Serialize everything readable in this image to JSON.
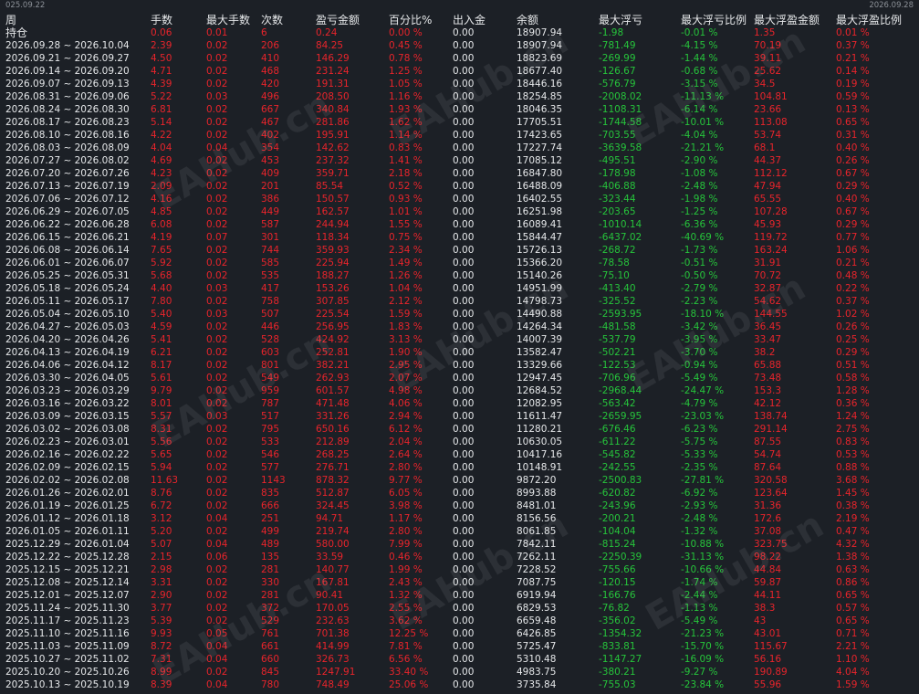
{
  "range": {
    "start": "025.09.22",
    "end": "2026.09.28"
  },
  "headers": [
    "周",
    "手数",
    "最大手数",
    "次数",
    "盈亏金额",
    "百分比%",
    "出入金",
    "余额",
    "最大浮亏",
    "最大浮亏比例",
    "最大浮盈金额",
    "最大浮盈比例"
  ],
  "holding": [
    "持仓",
    "0.06",
    "0.01",
    "6",
    "0.24",
    "0.00 %",
    "0.00",
    "18907.94",
    "-1.98",
    "-0.01 %",
    "1.35",
    "0.01 %"
  ],
  "rows": [
    [
      "2026.09.28 ~ 2026.10.04",
      "2.39",
      "0.02",
      "206",
      "84.25",
      "0.45 %",
      "0.00",
      "18907.94",
      "-781.49",
      "-4.15 %",
      "70.19",
      "0.37 %"
    ],
    [
      "2026.09.21 ~ 2026.09.27",
      "4.50",
      "0.02",
      "410",
      "146.29",
      "0.78 %",
      "0.00",
      "18823.69",
      "-269.99",
      "-1.44 %",
      "39.11",
      "0.21 %"
    ],
    [
      "2026.09.14 ~ 2026.09.20",
      "4.71",
      "0.02",
      "468",
      "231.24",
      "1.25 %",
      "0.00",
      "18677.40",
      "-126.67",
      "-0.68 %",
      "25.62",
      "0.14 %"
    ],
    [
      "2026.09.07 ~ 2026.09.13",
      "4.39",
      "0.02",
      "420",
      "191.31",
      "1.05 %",
      "0.00",
      "18446.16",
      "-576.79",
      "-3.15 %",
      "34.5",
      "0.19 %"
    ],
    [
      "2026.08.31 ~ 2026.09.06",
      "5.22",
      "0.03",
      "496",
      "208.50",
      "1.16 %",
      "0.00",
      "18254.85",
      "-2008.02",
      "-11.13 %",
      "104.81",
      "0.59 %"
    ],
    [
      "2026.08.24 ~ 2026.08.30",
      "6.81",
      "0.02",
      "667",
      "340.84",
      "1.93 %",
      "0.00",
      "18046.35",
      "-1108.31",
      "-6.14 %",
      "23.66",
      "0.13 %"
    ],
    [
      "2026.08.17 ~ 2026.08.23",
      "5.14",
      "0.02",
      "467",
      "281.86",
      "1.62 %",
      "0.00",
      "17705.51",
      "-1744.58",
      "-10.01 %",
      "113.08",
      "0.65 %"
    ],
    [
      "2026.08.10 ~ 2026.08.16",
      "4.22",
      "0.02",
      "402",
      "195.91",
      "1.14 %",
      "0.00",
      "17423.65",
      "-703.55",
      "-4.04 %",
      "53.74",
      "0.31 %"
    ],
    [
      "2026.08.03 ~ 2026.08.09",
      "4.04",
      "0.04",
      "354",
      "142.62",
      "0.83 %",
      "0.00",
      "17227.74",
      "-3639.58",
      "-21.21 %",
      "68.1",
      "0.40 %"
    ],
    [
      "2026.07.27 ~ 2026.08.02",
      "4.69",
      "0.02",
      "453",
      "237.32",
      "1.41 %",
      "0.00",
      "17085.12",
      "-495.51",
      "-2.90 %",
      "44.37",
      "0.26 %"
    ],
    [
      "2026.07.20 ~ 2026.07.26",
      "4.23",
      "0.02",
      "409",
      "359.71",
      "2.18 %",
      "0.00",
      "16847.80",
      "-178.98",
      "-1.08 %",
      "112.12",
      "0.67 %"
    ],
    [
      "2026.07.13 ~ 2026.07.19",
      "2.09",
      "0.02",
      "201",
      "85.54",
      "0.52 %",
      "0.00",
      "16488.09",
      "-406.88",
      "-2.48 %",
      "47.94",
      "0.29 %"
    ],
    [
      "2026.07.06 ~ 2026.07.12",
      "4.16",
      "0.02",
      "386",
      "150.57",
      "0.93 %",
      "0.00",
      "16402.55",
      "-323.44",
      "-1.98 %",
      "65.55",
      "0.40 %"
    ],
    [
      "2026.06.29 ~ 2026.07.05",
      "4.85",
      "0.02",
      "449",
      "162.57",
      "1.01 %",
      "0.00",
      "16251.98",
      "-203.65",
      "-1.25 %",
      "107.28",
      "0.67 %"
    ],
    [
      "2026.06.22 ~ 2026.06.28",
      "6.08",
      "0.02",
      "587",
      "244.94",
      "1.55 %",
      "0.00",
      "16089.41",
      "-1010.14",
      "-6.36 %",
      "45.93",
      "0.29 %"
    ],
    [
      "2026.06.15 ~ 2026.06.21",
      "4.19",
      "0.07",
      "301",
      "118.34",
      "0.75 %",
      "0.00",
      "15844.47",
      "-6437.02",
      "-40.69 %",
      "119.72",
      "0.77 %"
    ],
    [
      "2026.06.08 ~ 2026.06.14",
      "7.65",
      "0.02",
      "744",
      "359.93",
      "2.34 %",
      "0.00",
      "15726.13",
      "-268.72",
      "-1.73 %",
      "163.24",
      "1.06 %"
    ],
    [
      "2026.06.01 ~ 2026.06.07",
      "5.92",
      "0.02",
      "585",
      "225.94",
      "1.49 %",
      "0.00",
      "15366.20",
      "-78.58",
      "-0.51 %",
      "31.91",
      "0.21 %"
    ],
    [
      "2026.05.25 ~ 2026.05.31",
      "5.68",
      "0.02",
      "535",
      "188.27",
      "1.26 %",
      "0.00",
      "15140.26",
      "-75.10",
      "-0.50 %",
      "70.72",
      "0.48 %"
    ],
    [
      "2026.05.18 ~ 2026.05.24",
      "4.40",
      "0.03",
      "417",
      "153.26",
      "1.04 %",
      "0.00",
      "14951.99",
      "-413.40",
      "-2.79 %",
      "32.87",
      "0.22 %"
    ],
    [
      "2026.05.11 ~ 2026.05.17",
      "7.80",
      "0.02",
      "758",
      "307.85",
      "2.12 %",
      "0.00",
      "14798.73",
      "-325.52",
      "-2.23 %",
      "54.62",
      "0.37 %"
    ],
    [
      "2026.05.04 ~ 2026.05.10",
      "5.40",
      "0.03",
      "507",
      "225.54",
      "1.59 %",
      "0.00",
      "14490.88",
      "-2593.95",
      "-18.10 %",
      "144.55",
      "1.02 %"
    ],
    [
      "2026.04.27 ~ 2026.05.03",
      "4.59",
      "0.02",
      "446",
      "256.95",
      "1.83 %",
      "0.00",
      "14264.34",
      "-481.58",
      "-3.42 %",
      "36.45",
      "0.26 %"
    ],
    [
      "2026.04.20 ~ 2026.04.26",
      "5.41",
      "0.02",
      "528",
      "424.92",
      "3.13 %",
      "0.00",
      "14007.39",
      "-537.79",
      "-3.95 %",
      "33.47",
      "0.25 %"
    ],
    [
      "2026.04.13 ~ 2026.04.19",
      "6.21",
      "0.02",
      "603",
      "252.81",
      "1.90 %",
      "0.00",
      "13582.47",
      "-502.21",
      "-3.70 %",
      "38.2",
      "0.29 %"
    ],
    [
      "2026.04.06 ~ 2026.04.12",
      "8.17",
      "0.02",
      "801",
      "382.21",
      "2.95 %",
      "0.00",
      "13329.66",
      "-122.53",
      "-0.94 %",
      "65.88",
      "0.51 %"
    ],
    [
      "2026.03.30 ~ 2026.04.05",
      "5.61",
      "0.02",
      "549",
      "262.93",
      "2.07 %",
      "0.00",
      "12947.45",
      "-706.96",
      "-5.49 %",
      "73.48",
      "0.58 %"
    ],
    [
      "2026.03.23 ~ 2026.03.29",
      "9.79",
      "0.02",
      "959",
      "601.57",
      "4.98 %",
      "0.00",
      "12684.52",
      "-2968.44",
      "-24.47 %",
      "153.3",
      "1.28 %"
    ],
    [
      "2026.03.16 ~ 2026.03.22",
      "8.01",
      "0.02",
      "787",
      "471.48",
      "4.06 %",
      "0.00",
      "12082.95",
      "-563.42",
      "-4.79 %",
      "42.12",
      "0.36 %"
    ],
    [
      "2026.03.09 ~ 2026.03.15",
      "5.57",
      "0.03",
      "517",
      "331.26",
      "2.94 %",
      "0.00",
      "11611.47",
      "-2659.95",
      "-23.03 %",
      "138.74",
      "1.24 %"
    ],
    [
      "2026.03.02 ~ 2026.03.08",
      "8.31",
      "0.02",
      "795",
      "650.16",
      "6.12 %",
      "0.00",
      "11280.21",
      "-676.46",
      "-6.23 %",
      "291.14",
      "2.75 %"
    ],
    [
      "2026.02.23 ~ 2026.03.01",
      "5.56",
      "0.02",
      "533",
      "212.89",
      "2.04 %",
      "0.00",
      "10630.05",
      "-611.22",
      "-5.75 %",
      "87.55",
      "0.83 %"
    ],
    [
      "2026.02.16 ~ 2026.02.22",
      "5.65",
      "0.02",
      "546",
      "268.25",
      "2.64 %",
      "0.00",
      "10417.16",
      "-545.82",
      "-5.33 %",
      "54.74",
      "0.53 %"
    ],
    [
      "2026.02.09 ~ 2026.02.15",
      "5.94",
      "0.02",
      "577",
      "276.71",
      "2.80 %",
      "0.00",
      "10148.91",
      "-242.55",
      "-2.35 %",
      "87.64",
      "0.88 %"
    ],
    [
      "2026.02.02 ~ 2026.02.08",
      "11.63",
      "0.02",
      "1143",
      "878.32",
      "9.77 %",
      "0.00",
      "9872.20",
      "-2500.83",
      "-27.81 %",
      "320.58",
      "3.68 %"
    ],
    [
      "2026.01.26 ~ 2026.02.01",
      "8.76",
      "0.02",
      "835",
      "512.87",
      "6.05 %",
      "0.00",
      "8993.88",
      "-620.82",
      "-6.92 %",
      "123.64",
      "1.45 %"
    ],
    [
      "2026.01.19 ~ 2026.01.25",
      "6.72",
      "0.02",
      "666",
      "324.45",
      "3.98 %",
      "0.00",
      "8481.01",
      "-243.96",
      "-2.93 %",
      "31.36",
      "0.38 %"
    ],
    [
      "2026.01.12 ~ 2026.01.18",
      "3.12",
      "0.04",
      "251",
      "94.71",
      "1.17 %",
      "0.00",
      "8156.56",
      "-200.21",
      "-2.48 %",
      "172.6",
      "2.19 %"
    ],
    [
      "2026.01.05 ~ 2026.01.11",
      "5.20",
      "0.02",
      "499",
      "219.74",
      "2.80 %",
      "0.00",
      "8061.85",
      "-104.04",
      "-1.32 %",
      "37.08",
      "0.47 %"
    ],
    [
      "2025.12.29 ~ 2026.01.04",
      "5.07",
      "0.04",
      "489",
      "580.00",
      "7.99 %",
      "0.00",
      "7842.11",
      "-815.24",
      "-10.88 %",
      "323.75",
      "4.32 %"
    ],
    [
      "2025.12.22 ~ 2025.12.28",
      "2.15",
      "0.06",
      "135",
      "33.59",
      "0.46 %",
      "0.00",
      "7262.11",
      "-2250.39",
      "-31.13 %",
      "98.22",
      "1.38 %"
    ],
    [
      "2025.12.15 ~ 2025.12.21",
      "2.98",
      "0.02",
      "281",
      "140.77",
      "1.99 %",
      "0.00",
      "7228.52",
      "-755.66",
      "-10.66 %",
      "44.84",
      "0.63 %"
    ],
    [
      "2025.12.08 ~ 2025.12.14",
      "3.31",
      "0.02",
      "330",
      "167.81",
      "2.43 %",
      "0.00",
      "7087.75",
      "-120.15",
      "-1.74 %",
      "59.87",
      "0.86 %"
    ],
    [
      "2025.12.01 ~ 2025.12.07",
      "2.90",
      "0.02",
      "281",
      "90.41",
      "1.32 %",
      "0.00",
      "6919.94",
      "-166.76",
      "-2.44 %",
      "44.11",
      "0.65 %"
    ],
    [
      "2025.11.24 ~ 2025.11.30",
      "3.77",
      "0.02",
      "372",
      "170.05",
      "2.55 %",
      "0.00",
      "6829.53",
      "-76.82",
      "-1.13 %",
      "38.3",
      "0.57 %"
    ],
    [
      "2025.11.17 ~ 2025.11.23",
      "5.39",
      "0.02",
      "529",
      "232.63",
      "3.62 %",
      "0.00",
      "6659.48",
      "-356.02",
      "-5.49 %",
      "43",
      "0.65 %"
    ],
    [
      "2025.11.10 ~ 2025.11.16",
      "9.93",
      "0.05",
      "761",
      "701.38",
      "12.25 %",
      "0.00",
      "6426.85",
      "-1354.32",
      "-21.23 %",
      "43.01",
      "0.71 %"
    ],
    [
      "2025.11.03 ~ 2025.11.09",
      "8.72",
      "0.04",
      "661",
      "414.99",
      "7.81 %",
      "0.00",
      "5725.47",
      "-833.81",
      "-15.70 %",
      "115.67",
      "2.21 %"
    ],
    [
      "2025.10.27 ~ 2025.11.02",
      "7.31",
      "0.04",
      "660",
      "326.73",
      "6.56 %",
      "0.00",
      "5310.48",
      "-1147.27",
      "-16.09 %",
      "56.16",
      "1.10 %"
    ],
    [
      "2025.10.20 ~ 2025.10.26",
      "8.99",
      "0.02",
      "845",
      "1247.91",
      "33.40 %",
      "0.00",
      "4983.75",
      "-380.21",
      "-9.27 %",
      "190.89",
      "4.04 %"
    ],
    [
      "2025.10.13 ~ 2025.10.19",
      "8.39",
      "0.04",
      "780",
      "748.49",
      "25.06 %",
      "0.00",
      "3735.84",
      "-755.03",
      "-23.84 %",
      "55.96",
      "1.59 %"
    ]
  ],
  "watermark": "EAHub.cn",
  "colors": {
    "background": "#1c2026",
    "positive": "#e8242b",
    "negative": "#26c43b",
    "text": "#e6e8ea"
  }
}
